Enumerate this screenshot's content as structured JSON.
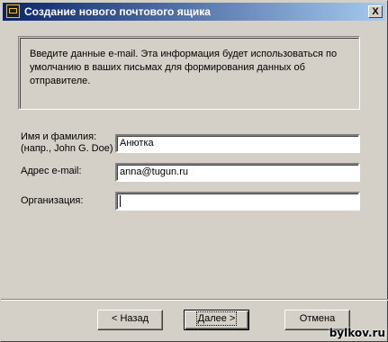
{
  "window": {
    "title": "Создание нового почтового ящика",
    "close_glyph": "X"
  },
  "info": {
    "text": "Введите данные e-mail. Эта информация будет использоваться по умолчанию в ваших письмах для формирования данных об отправителе."
  },
  "form": {
    "name_label_1": "Имя и фамилия:",
    "name_label_2": "(напр., John G. Doe)",
    "name_value": "Анютка",
    "email_label": "Адрес e-mail:",
    "email_value": "anna@tugun.ru",
    "org_label": "Организация:",
    "org_value": ""
  },
  "buttons": {
    "back": "<  Назад",
    "next": "Далее  >",
    "cancel": "Отмена"
  },
  "watermark": "bylkov.ru"
}
